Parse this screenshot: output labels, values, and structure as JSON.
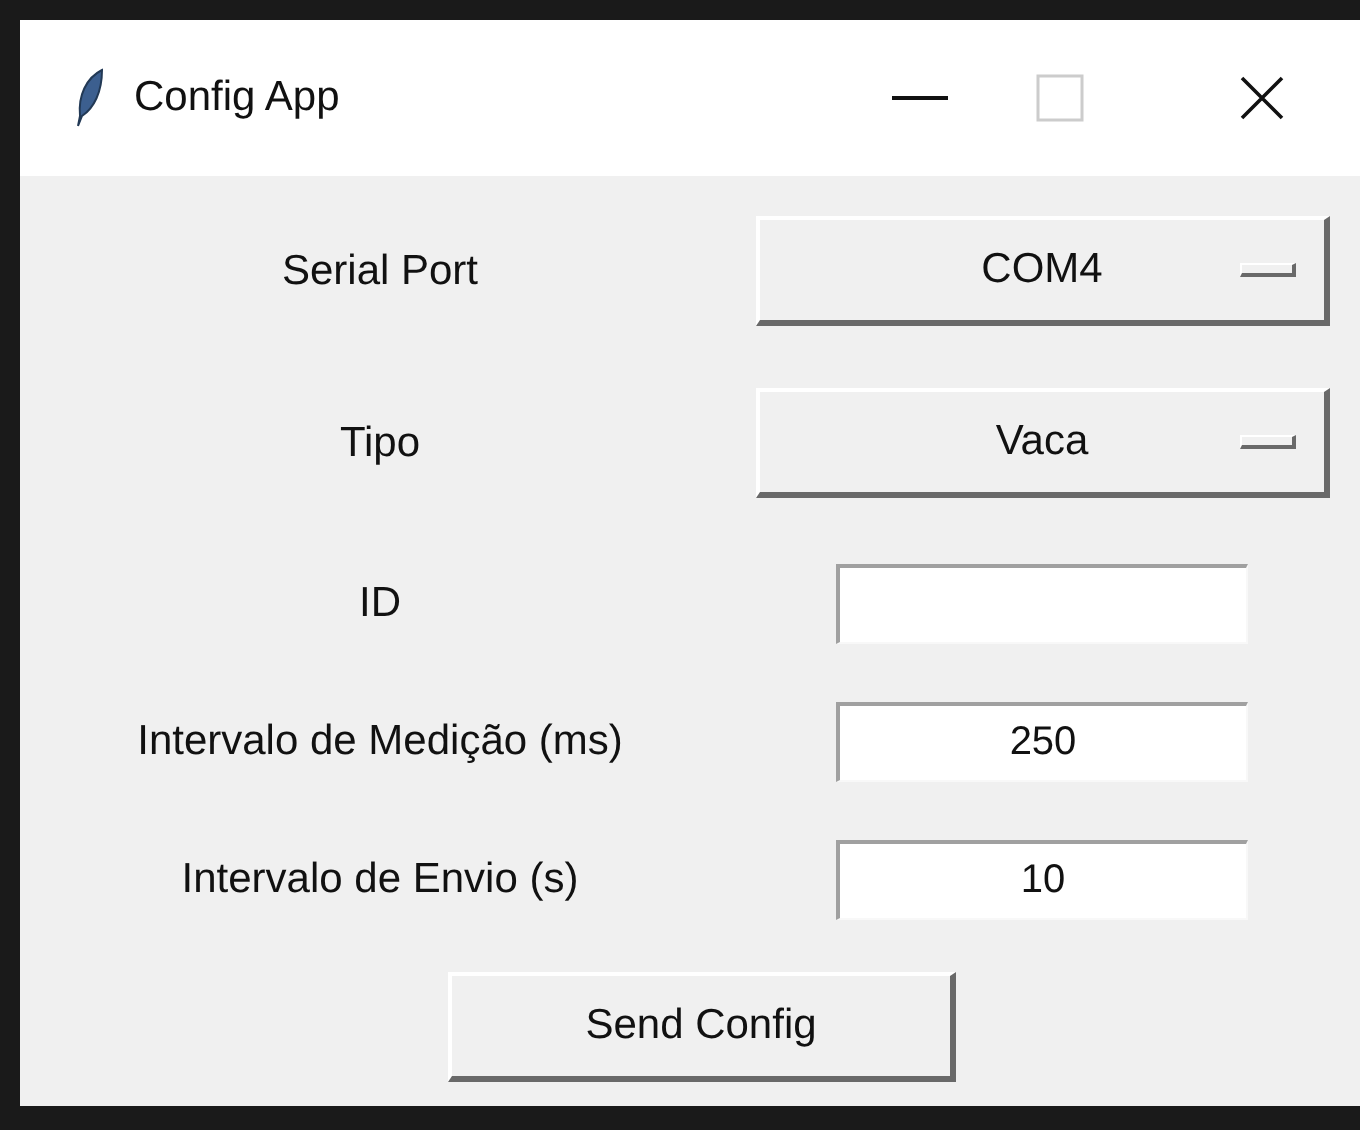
{
  "window": {
    "title": "Config App",
    "maximize_disabled": true
  },
  "fields": [
    {
      "kind": "dropdown",
      "label": "Serial Port",
      "value": "COM4"
    },
    {
      "kind": "dropdown",
      "label": "Tipo",
      "value": "Vaca"
    },
    {
      "kind": "entry",
      "label": "ID"
    },
    {
      "kind": "entry",
      "label": "Intervalo de Medição (ms)",
      "value": "250"
    },
    {
      "kind": "entry",
      "label": "Intervalo de Envio (s)",
      "value": "10"
    }
  ],
  "button": {
    "label": "Send Config"
  }
}
